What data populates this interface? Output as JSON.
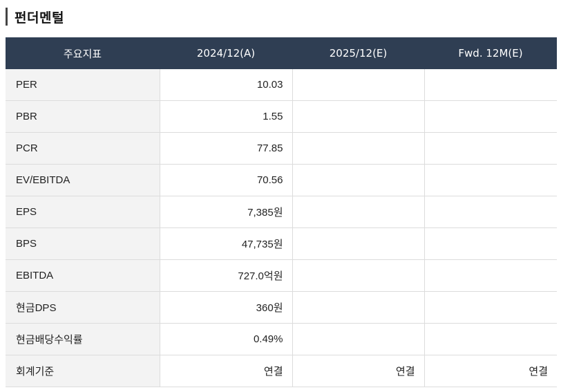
{
  "section": {
    "title": "펀더멘털"
  },
  "table": {
    "headers": [
      "주요지표",
      "2024/12(A)",
      "2025/12(E)",
      "Fwd. 12M(E)"
    ],
    "rows": [
      {
        "label": "PER",
        "values": [
          "10.03",
          "",
          ""
        ]
      },
      {
        "label": "PBR",
        "values": [
          "1.55",
          "",
          ""
        ]
      },
      {
        "label": "PCR",
        "values": [
          "77.85",
          "",
          ""
        ]
      },
      {
        "label": "EV/EBITDA",
        "values": [
          "70.56",
          "",
          ""
        ]
      },
      {
        "label": "EPS",
        "values": [
          "7,385원",
          "",
          ""
        ]
      },
      {
        "label": "BPS",
        "values": [
          "47,735원",
          "",
          ""
        ]
      },
      {
        "label": "EBITDA",
        "values": [
          "727.0억원",
          "",
          ""
        ]
      },
      {
        "label": "현금DPS",
        "values": [
          "360원",
          "",
          ""
        ]
      },
      {
        "label": "현금배당수익률",
        "values": [
          "0.49%",
          "",
          ""
        ]
      },
      {
        "label": "회계기준",
        "values": [
          "연결",
          "연결",
          "연결"
        ]
      }
    ]
  }
}
